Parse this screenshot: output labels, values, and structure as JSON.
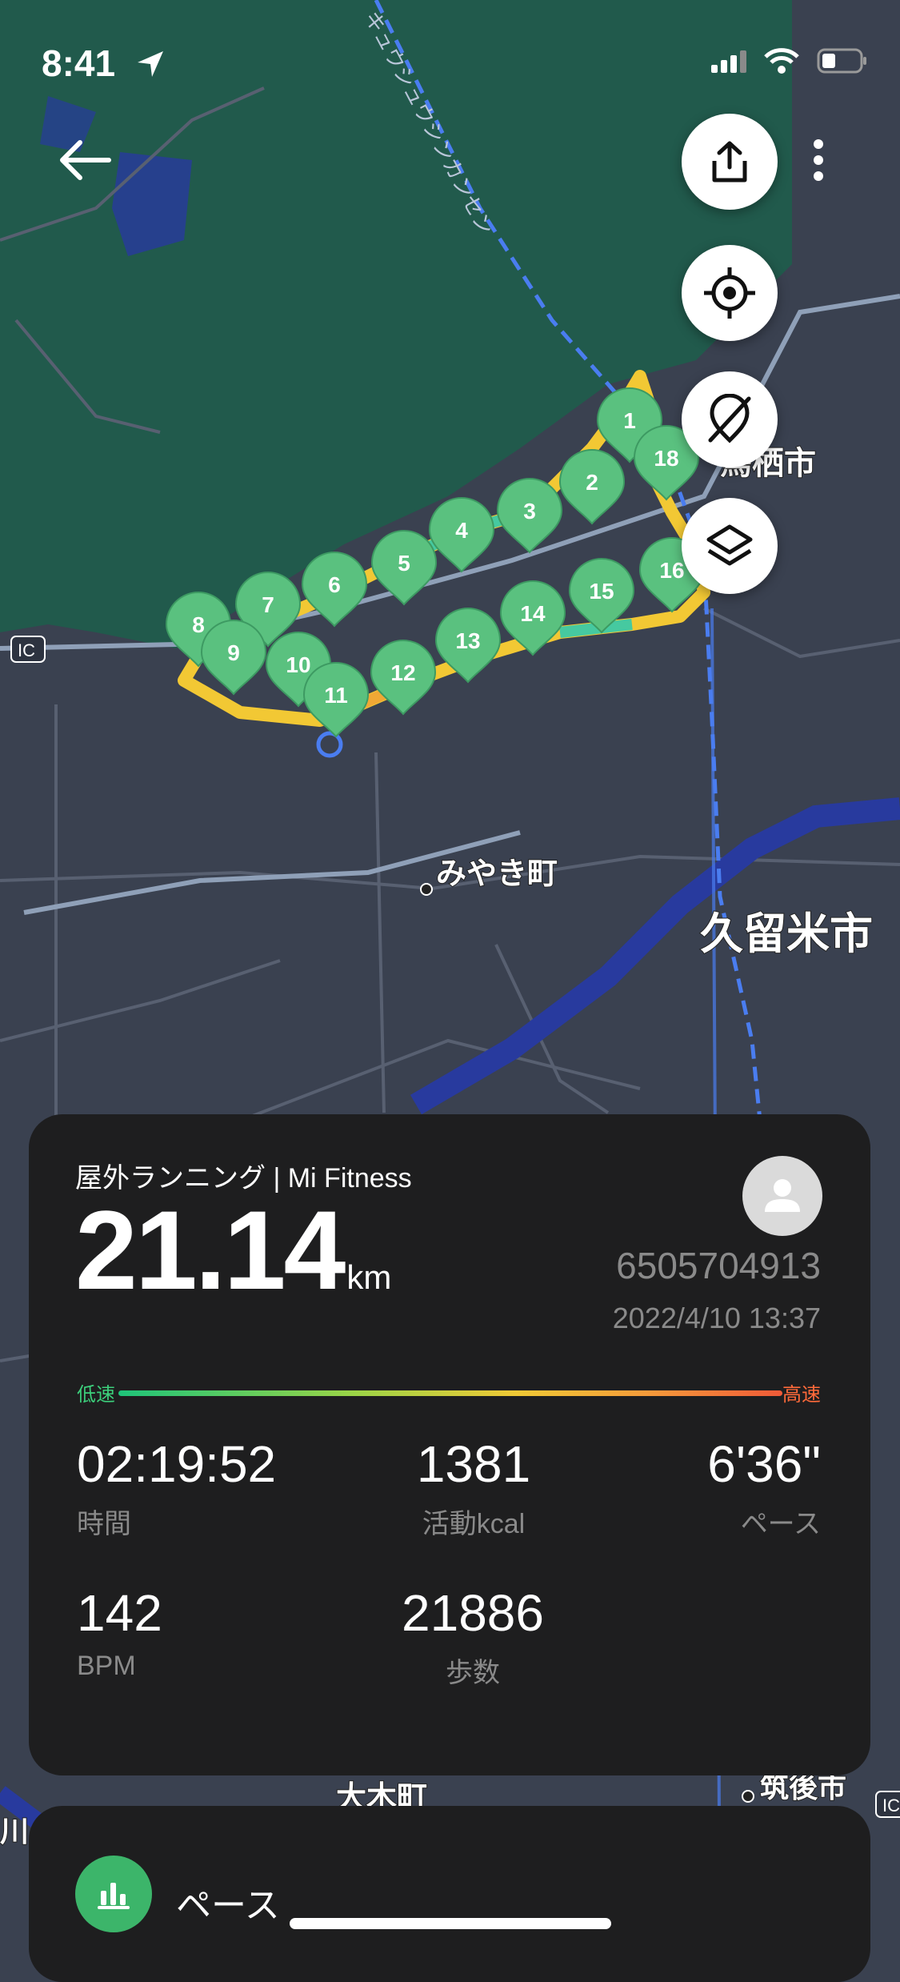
{
  "status": {
    "time": "8:41"
  },
  "map": {
    "rail_label": "キュウシュウシンカンセン",
    "places": {
      "tosu": "鳥栖市",
      "miyaki": "みやき町",
      "kurume": "久留米市",
      "oki": "大木町",
      "chikugo": "筑後市",
      "ic_left": "IC",
      "ic_right": "IC",
      "edge": "川の"
    },
    "markers": [
      "1",
      "2",
      "3",
      "4",
      "5",
      "6",
      "7",
      "8",
      "9",
      "10",
      "11",
      "12",
      "13",
      "14",
      "15",
      "16",
      "18"
    ]
  },
  "workout": {
    "title": "屋外ランニング | Mi Fitness",
    "distance": "21.14",
    "distance_unit": "km",
    "user_id": "6505704913",
    "datetime": "2022/4/10 13:37",
    "legend_low": "低速",
    "legend_high": "高速",
    "stats": [
      {
        "value": "02:19:52",
        "label": "時間"
      },
      {
        "value": "1381",
        "label": "活動kcal"
      },
      {
        "value": "6'36\"",
        "label": "ペース"
      },
      {
        "value": "142",
        "label": "BPM"
      },
      {
        "value": "21886",
        "label": "歩数"
      }
    ]
  },
  "sheet": {
    "label": "ペース"
  },
  "colors": {
    "accent": "#3cb56a",
    "route_slow": "#1ec47a",
    "route_fast": "#f05a38",
    "card": "#1e1e1f"
  }
}
